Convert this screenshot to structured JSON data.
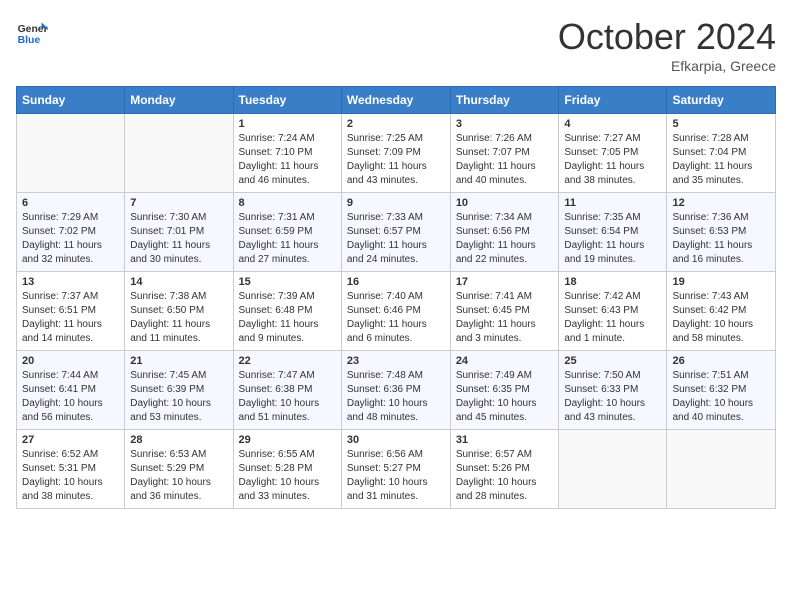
{
  "header": {
    "logo_general": "General",
    "logo_blue": "Blue",
    "month_title": "October 2024",
    "location": "Efkarpia, Greece"
  },
  "weekdays": [
    "Sunday",
    "Monday",
    "Tuesday",
    "Wednesday",
    "Thursday",
    "Friday",
    "Saturday"
  ],
  "weeks": [
    [
      {
        "day": "",
        "sunrise": "",
        "sunset": "",
        "daylight": ""
      },
      {
        "day": "",
        "sunrise": "",
        "sunset": "",
        "daylight": ""
      },
      {
        "day": "1",
        "sunrise": "Sunrise: 7:24 AM",
        "sunset": "Sunset: 7:10 PM",
        "daylight": "Daylight: 11 hours and 46 minutes."
      },
      {
        "day": "2",
        "sunrise": "Sunrise: 7:25 AM",
        "sunset": "Sunset: 7:09 PM",
        "daylight": "Daylight: 11 hours and 43 minutes."
      },
      {
        "day": "3",
        "sunrise": "Sunrise: 7:26 AM",
        "sunset": "Sunset: 7:07 PM",
        "daylight": "Daylight: 11 hours and 40 minutes."
      },
      {
        "day": "4",
        "sunrise": "Sunrise: 7:27 AM",
        "sunset": "Sunset: 7:05 PM",
        "daylight": "Daylight: 11 hours and 38 minutes."
      },
      {
        "day": "5",
        "sunrise": "Sunrise: 7:28 AM",
        "sunset": "Sunset: 7:04 PM",
        "daylight": "Daylight: 11 hours and 35 minutes."
      }
    ],
    [
      {
        "day": "6",
        "sunrise": "Sunrise: 7:29 AM",
        "sunset": "Sunset: 7:02 PM",
        "daylight": "Daylight: 11 hours and 32 minutes."
      },
      {
        "day": "7",
        "sunrise": "Sunrise: 7:30 AM",
        "sunset": "Sunset: 7:01 PM",
        "daylight": "Daylight: 11 hours and 30 minutes."
      },
      {
        "day": "8",
        "sunrise": "Sunrise: 7:31 AM",
        "sunset": "Sunset: 6:59 PM",
        "daylight": "Daylight: 11 hours and 27 minutes."
      },
      {
        "day": "9",
        "sunrise": "Sunrise: 7:33 AM",
        "sunset": "Sunset: 6:57 PM",
        "daylight": "Daylight: 11 hours and 24 minutes."
      },
      {
        "day": "10",
        "sunrise": "Sunrise: 7:34 AM",
        "sunset": "Sunset: 6:56 PM",
        "daylight": "Daylight: 11 hours and 22 minutes."
      },
      {
        "day": "11",
        "sunrise": "Sunrise: 7:35 AM",
        "sunset": "Sunset: 6:54 PM",
        "daylight": "Daylight: 11 hours and 19 minutes."
      },
      {
        "day": "12",
        "sunrise": "Sunrise: 7:36 AM",
        "sunset": "Sunset: 6:53 PM",
        "daylight": "Daylight: 11 hours and 16 minutes."
      }
    ],
    [
      {
        "day": "13",
        "sunrise": "Sunrise: 7:37 AM",
        "sunset": "Sunset: 6:51 PM",
        "daylight": "Daylight: 11 hours and 14 minutes."
      },
      {
        "day": "14",
        "sunrise": "Sunrise: 7:38 AM",
        "sunset": "Sunset: 6:50 PM",
        "daylight": "Daylight: 11 hours and 11 minutes."
      },
      {
        "day": "15",
        "sunrise": "Sunrise: 7:39 AM",
        "sunset": "Sunset: 6:48 PM",
        "daylight": "Daylight: 11 hours and 9 minutes."
      },
      {
        "day": "16",
        "sunrise": "Sunrise: 7:40 AM",
        "sunset": "Sunset: 6:46 PM",
        "daylight": "Daylight: 11 hours and 6 minutes."
      },
      {
        "day": "17",
        "sunrise": "Sunrise: 7:41 AM",
        "sunset": "Sunset: 6:45 PM",
        "daylight": "Daylight: 11 hours and 3 minutes."
      },
      {
        "day": "18",
        "sunrise": "Sunrise: 7:42 AM",
        "sunset": "Sunset: 6:43 PM",
        "daylight": "Daylight: 11 hours and 1 minute."
      },
      {
        "day": "19",
        "sunrise": "Sunrise: 7:43 AM",
        "sunset": "Sunset: 6:42 PM",
        "daylight": "Daylight: 10 hours and 58 minutes."
      }
    ],
    [
      {
        "day": "20",
        "sunrise": "Sunrise: 7:44 AM",
        "sunset": "Sunset: 6:41 PM",
        "daylight": "Daylight: 10 hours and 56 minutes."
      },
      {
        "day": "21",
        "sunrise": "Sunrise: 7:45 AM",
        "sunset": "Sunset: 6:39 PM",
        "daylight": "Daylight: 10 hours and 53 minutes."
      },
      {
        "day": "22",
        "sunrise": "Sunrise: 7:47 AM",
        "sunset": "Sunset: 6:38 PM",
        "daylight": "Daylight: 10 hours and 51 minutes."
      },
      {
        "day": "23",
        "sunrise": "Sunrise: 7:48 AM",
        "sunset": "Sunset: 6:36 PM",
        "daylight": "Daylight: 10 hours and 48 minutes."
      },
      {
        "day": "24",
        "sunrise": "Sunrise: 7:49 AM",
        "sunset": "Sunset: 6:35 PM",
        "daylight": "Daylight: 10 hours and 45 minutes."
      },
      {
        "day": "25",
        "sunrise": "Sunrise: 7:50 AM",
        "sunset": "Sunset: 6:33 PM",
        "daylight": "Daylight: 10 hours and 43 minutes."
      },
      {
        "day": "26",
        "sunrise": "Sunrise: 7:51 AM",
        "sunset": "Sunset: 6:32 PM",
        "daylight": "Daylight: 10 hours and 40 minutes."
      }
    ],
    [
      {
        "day": "27",
        "sunrise": "Sunrise: 6:52 AM",
        "sunset": "Sunset: 5:31 PM",
        "daylight": "Daylight: 10 hours and 38 minutes."
      },
      {
        "day": "28",
        "sunrise": "Sunrise: 6:53 AM",
        "sunset": "Sunset: 5:29 PM",
        "daylight": "Daylight: 10 hours and 36 minutes."
      },
      {
        "day": "29",
        "sunrise": "Sunrise: 6:55 AM",
        "sunset": "Sunset: 5:28 PM",
        "daylight": "Daylight: 10 hours and 33 minutes."
      },
      {
        "day": "30",
        "sunrise": "Sunrise: 6:56 AM",
        "sunset": "Sunset: 5:27 PM",
        "daylight": "Daylight: 10 hours and 31 minutes."
      },
      {
        "day": "31",
        "sunrise": "Sunrise: 6:57 AM",
        "sunset": "Sunset: 5:26 PM",
        "daylight": "Daylight: 10 hours and 28 minutes."
      },
      {
        "day": "",
        "sunrise": "",
        "sunset": "",
        "daylight": ""
      },
      {
        "day": "",
        "sunrise": "",
        "sunset": "",
        "daylight": ""
      }
    ]
  ]
}
